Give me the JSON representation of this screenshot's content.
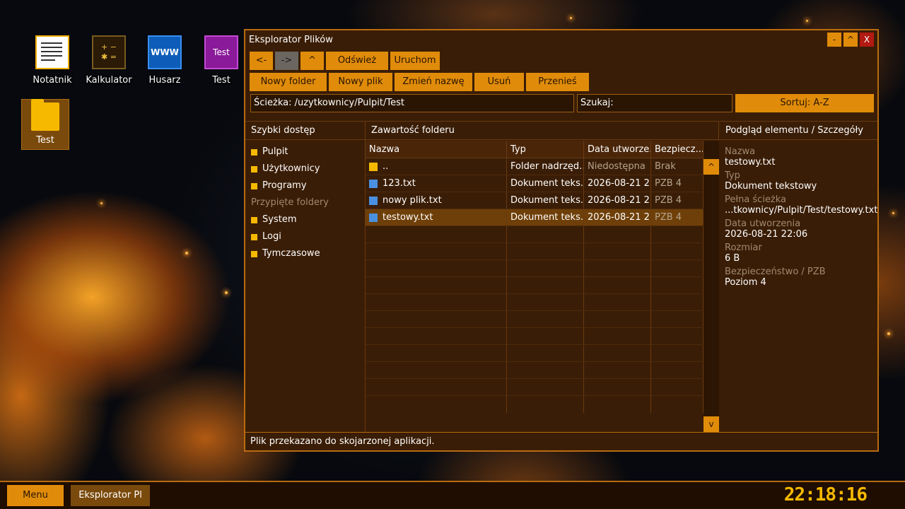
{
  "desktop": {
    "icons": [
      {
        "label": "Notatnik",
        "icon": "notepad-icon"
      },
      {
        "label": "Kalkulator",
        "icon": "calculator-icon",
        "glyph_top": "+ −",
        "glyph_bottom": "✱ ="
      },
      {
        "label": "Husarz",
        "icon": "browser-icon",
        "glyph": "WWW"
      },
      {
        "label": "Test",
        "icon": "test-program-icon",
        "glyph": "Test"
      }
    ],
    "folder": {
      "label": "Test",
      "icon": "folder-icon"
    }
  },
  "window": {
    "title": "Eksplorator Plików",
    "controls": {
      "minimize": "-",
      "maximize": "^",
      "close": "X"
    },
    "nav": {
      "back": "<-",
      "forward": "->",
      "up": "^",
      "refresh": "Odśwież",
      "run": "Uruchom"
    },
    "actions": {
      "new_folder": "Nowy folder",
      "new_file": "Nowy plik",
      "rename": "Zmień nazwę",
      "delete": "Usuń",
      "move": "Przenieś"
    },
    "path": "Ścieżka: /uzytkownicy/Pulpit/Test",
    "search": "Szukaj:",
    "sort": "Sortuj: A-Z",
    "quick_access": {
      "title": "Szybki dostęp",
      "items": [
        "Pulpit",
        "Użytkownicy",
        "Programy"
      ],
      "pinned_header": "Przypięte foldery",
      "pinned": [
        "System",
        "Logi",
        "Tymczasowe"
      ]
    },
    "content": {
      "title": "Zawartość folderu",
      "columns": [
        "Nazwa",
        "Typ",
        "Data utworze...",
        "Bezpiecz..."
      ],
      "rows": [
        {
          "name": "..",
          "type": "Folder nadrzęd...",
          "date": "Niedostępna",
          "sec": "Brak",
          "kind": "folder"
        },
        {
          "name": "123.txt",
          "type": "Dokument teks...",
          "date": "2026-08-21 2...",
          "sec": "PZB 4",
          "kind": "doc"
        },
        {
          "name": "nowy plik.txt",
          "type": "Dokument teks...",
          "date": "2026-08-21 2...",
          "sec": "PZB 4",
          "kind": "doc"
        },
        {
          "name": "testowy.txt",
          "type": "Dokument teks...",
          "date": "2026-08-21 2...",
          "sec": "PZB 4",
          "kind": "doc",
          "selected": true
        }
      ],
      "scroll_up": "^",
      "scroll_down": "v"
    },
    "details": {
      "title": "Podgląd elementu / Szczegóły",
      "fields": [
        {
          "label": "Nazwa",
          "value": "testowy.txt"
        },
        {
          "label": "Typ",
          "value": "Dokument tekstowy"
        },
        {
          "label": "Pełna ścieżka",
          "value": "...tkownicy/Pulpit/Test/testowy.txt"
        },
        {
          "label": "Data utworzenia",
          "value": "2026-08-21 22:06"
        },
        {
          "label": "Rozmiar",
          "value": "6 B"
        },
        {
          "label": "Bezpieczeństwo / PZB",
          "value": "Poziom 4"
        }
      ]
    },
    "status": "Plik przekazano do skojarzonej aplikacji."
  },
  "taskbar": {
    "menu": "Menu",
    "app": "Eksplorator Pl",
    "clock": "22:18:16"
  },
  "colors": {
    "accent": "#e08c0a",
    "folder": "#f7b900",
    "document": "#4a90e0",
    "window_bg": "#3a1d06",
    "close": "#b21a12"
  }
}
